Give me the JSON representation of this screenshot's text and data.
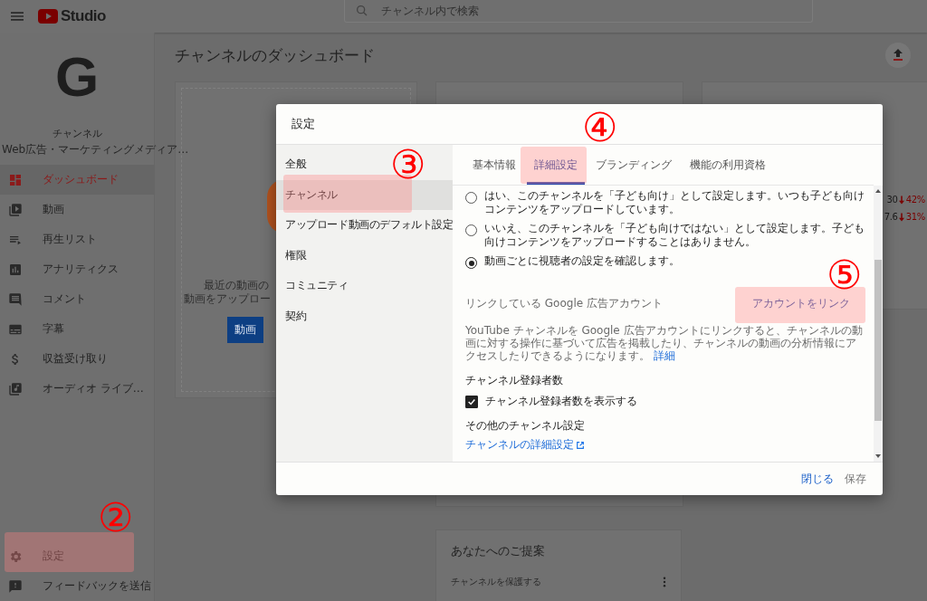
{
  "topbar": {
    "logo_text": "Studio",
    "search": {
      "placeholder": "チャンネル内で検索"
    }
  },
  "sidebar": {
    "avatar_letter": "G",
    "channel_name": "チャンネル",
    "channel_subtitle": "Web広告・マーケティングメディア…",
    "items": [
      {
        "label": "ダッシュボード",
        "selected": true
      },
      {
        "label": "動画",
        "selected": false
      },
      {
        "label": "再生リスト",
        "selected": false
      },
      {
        "label": "アナリティクス",
        "selected": false
      },
      {
        "label": "コメント",
        "selected": false
      },
      {
        "label": "字幕",
        "selected": false
      },
      {
        "label": "収益受け取り",
        "selected": false
      },
      {
        "label": "オーディオ ライブ…",
        "selected": false
      }
    ],
    "bottom_items": [
      {
        "label": "設定",
        "selected": false
      },
      {
        "label": "フィードバックを送信",
        "selected": false
      }
    ]
  },
  "page_title": "チャンネルのダッシュボード",
  "upload_card": {
    "text_lines": [
      "最近の動画の",
      "動画をアップロー"
    ],
    "button": "動画"
  },
  "analytics_rows": [
    {
      "value": "30",
      "change": "42%"
    },
    {
      "value": "7.6",
      "change": "31%"
    }
  ],
  "suggestions_card": {
    "title": "あなたへのご提案",
    "items": [
      "チャンネルを保護する"
    ]
  },
  "dialog": {
    "title": "設定",
    "nav": [
      {
        "label": "全般",
        "selected": false
      },
      {
        "label": "チャンネル",
        "selected": true
      },
      {
        "label": "アップロード動画のデフォルト設定",
        "selected": false
      },
      {
        "label": "権限",
        "selected": false
      },
      {
        "label": "コミュニティ",
        "selected": false
      },
      {
        "label": "契約",
        "selected": false
      }
    ],
    "tabs": [
      {
        "label": "基本情報",
        "selected": false
      },
      {
        "label": "詳細設定",
        "selected": true
      },
      {
        "label": "ブランディング",
        "selected": false
      },
      {
        "label": "機能の利用資格",
        "selected": false
      }
    ],
    "audience_options": [
      {
        "label": "はい、このチャンネルを「子ども向け」として設定します。いつも子ども向けコンテンツをアップロードしています。",
        "selected": false
      },
      {
        "label": "いいえ、このチャンネルを「子ども向けではない」として設定します。子ども向けコンテンツをアップロードすることはありません。",
        "selected": false
      },
      {
        "label": "動画ごとに視聴者の設定を確認します。",
        "selected": true
      }
    ],
    "ads_section": {
      "label": "リンクしている Google 広告アカウント",
      "link_button": "アカウントをリンク",
      "description": "YouTube チャンネルを Google 広告アカウントにリンクすると、チャンネルの動画に対する操作に基づいて広告を掲載したり、チャンネルの動画の分析情報にアクセスしたりできるようになります。",
      "details_link": "詳細"
    },
    "subscribers_section": {
      "heading": "チャンネル登録者数",
      "checkbox": {
        "label": "チャンネル登録者数を表示する",
        "checked": true
      }
    },
    "other_section": {
      "heading": "その他のチャンネル設定",
      "link": "チャンネルの詳細設定"
    },
    "footer_buttons": [
      {
        "label": "閉じる",
        "kind": "primary"
      },
      {
        "label": "保存",
        "kind": "disabled"
      }
    ]
  },
  "annotations": [
    "②",
    "③",
    "④",
    "⑤"
  ]
}
